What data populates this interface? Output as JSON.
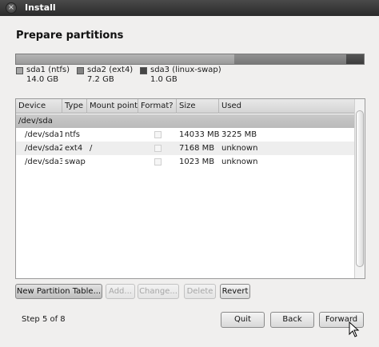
{
  "window": {
    "title": "Install",
    "close_glyph": "×"
  },
  "page": {
    "heading": "Prepare partitions"
  },
  "partition_bar": [
    {
      "name": "sda1 (ntfs)",
      "size": "14.0 GB",
      "fraction": 0.628,
      "color": "#a6a6a6"
    },
    {
      "name": "sda2 (ext4)",
      "size": "7.2 GB",
      "fraction": 0.321,
      "color": "#838383"
    },
    {
      "name": "sda3 (linux-swap)",
      "size": "1.0 GB",
      "fraction": 0.051,
      "color": "#464646"
    }
  ],
  "table": {
    "headers": [
      "Device",
      "Type",
      "Mount point",
      "Format?",
      "Size",
      "Used"
    ],
    "group": "/dev/sda",
    "rows": [
      {
        "device": "/dev/sda1",
        "type": "ntfs",
        "mount": "",
        "format": false,
        "size": "14033 MB",
        "used": "3225 MB"
      },
      {
        "device": "/dev/sda2",
        "type": "ext4",
        "mount": "/",
        "format": false,
        "size": "7168 MB",
        "used": "unknown"
      },
      {
        "device": "/dev/sda3",
        "type": "swap",
        "mount": "",
        "format": false,
        "size": "1023 MB",
        "used": "unknown"
      }
    ]
  },
  "actions": {
    "new_partition_table": "New Partition Table...",
    "add": "Add...",
    "change": "Change...",
    "delete": "Delete",
    "revert": "Revert"
  },
  "footer": {
    "step": "Step 5 of 8",
    "quit": "Quit",
    "back": "Back",
    "forward": "Forward"
  }
}
